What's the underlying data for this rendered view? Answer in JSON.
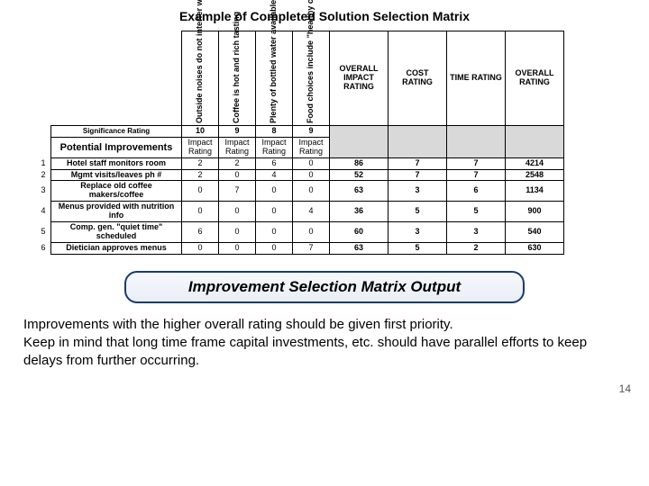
{
  "title": "Example of Completed Solution Selection Matrix",
  "criteria": [
    "Outside noises do not interfer with speakers",
    "Coffee is hot and rich tasting",
    "Plenty of bottled water available",
    "Food choices include \"healthy choices\""
  ],
  "rating_cols": {
    "overall_impact": "OVERALL IMPACT RATING",
    "cost": "COST RATING",
    "time": "TIME RATING",
    "overall": "OVERALL RATING"
  },
  "sig_label": "Significance Rating",
  "sig_values": [
    "10",
    "9",
    "8",
    "9"
  ],
  "potential_label": "Potential Improvements",
  "impact_label": "Impact Rating",
  "rows": [
    {
      "n": "1",
      "name": "Hotel staff monitors room",
      "v": [
        "2",
        "2",
        "6",
        "0"
      ],
      "oimp": "86",
      "cost": "7",
      "time": "7",
      "over": "4214"
    },
    {
      "n": "2",
      "name": "Mgmt visits/leaves ph #",
      "v": [
        "2",
        "0",
        "4",
        "0"
      ],
      "oimp": "52",
      "cost": "7",
      "time": "7",
      "over": "2548"
    },
    {
      "n": "3",
      "name": "Replace old coffee makers/coffee",
      "v": [
        "0",
        "7",
        "0",
        "0"
      ],
      "oimp": "63",
      "cost": "3",
      "time": "6",
      "over": "1134"
    },
    {
      "n": "4",
      "name": "Menus provided with nutrition info",
      "v": [
        "0",
        "0",
        "0",
        "4"
      ],
      "oimp": "36",
      "cost": "5",
      "time": "5",
      "over": "900"
    },
    {
      "n": "5",
      "name": "Comp. gen. \"quiet time\" scheduled",
      "v": [
        "6",
        "0",
        "0",
        "0"
      ],
      "oimp": "60",
      "cost": "3",
      "time": "3",
      "over": "540"
    },
    {
      "n": "6",
      "name": "Dietician approves menus",
      "v": [
        "0",
        "0",
        "0",
        "7"
      ],
      "oimp": "63",
      "cost": "5",
      "time": "2",
      "over": "630"
    }
  ],
  "banner": "Improvement Selection Matrix Output",
  "body1": "Improvements with the higher overall rating should be given first priority.",
  "body2": "Keep in mind that long time frame capital investments, etc. should have parallel efforts to keep delays from further occurring.",
  "page": "14"
}
